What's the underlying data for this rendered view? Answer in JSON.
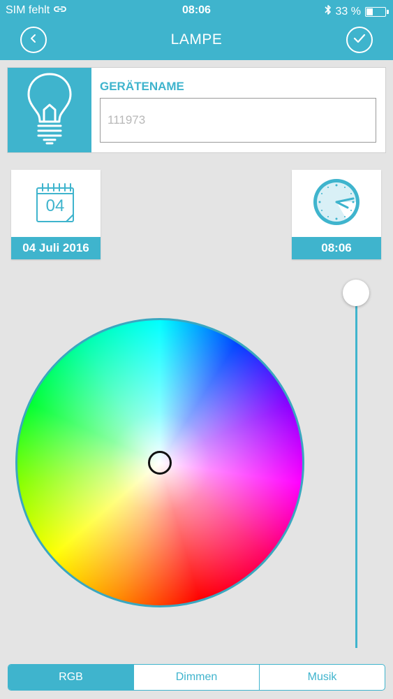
{
  "status_bar": {
    "carrier": "SIM fehlt",
    "time": "08:06",
    "battery_text": "33 %",
    "battery_level_percent": 33
  },
  "header": {
    "title": "LAMPE",
    "back_icon": "chevron-left-icon",
    "confirm_icon": "check-icon"
  },
  "device": {
    "label": "GERÄTENAME",
    "value": "111973",
    "icon": "lightbulb-icon"
  },
  "date_tile": {
    "calendar_day": "04",
    "label": "04 Juli 2016",
    "icon": "calendar-icon"
  },
  "time_tile": {
    "label": "08:06",
    "icon": "clock-icon"
  },
  "color_wheel": {
    "selection": "center"
  },
  "brightness_slider": {
    "value_percent": 100
  },
  "tabs": [
    {
      "label": "RGB",
      "active": true
    },
    {
      "label": "Dimmen",
      "active": false
    },
    {
      "label": "Musik",
      "active": false
    }
  ],
  "colors": {
    "accent": "#3fb4cd",
    "background": "#e4e4e4"
  }
}
